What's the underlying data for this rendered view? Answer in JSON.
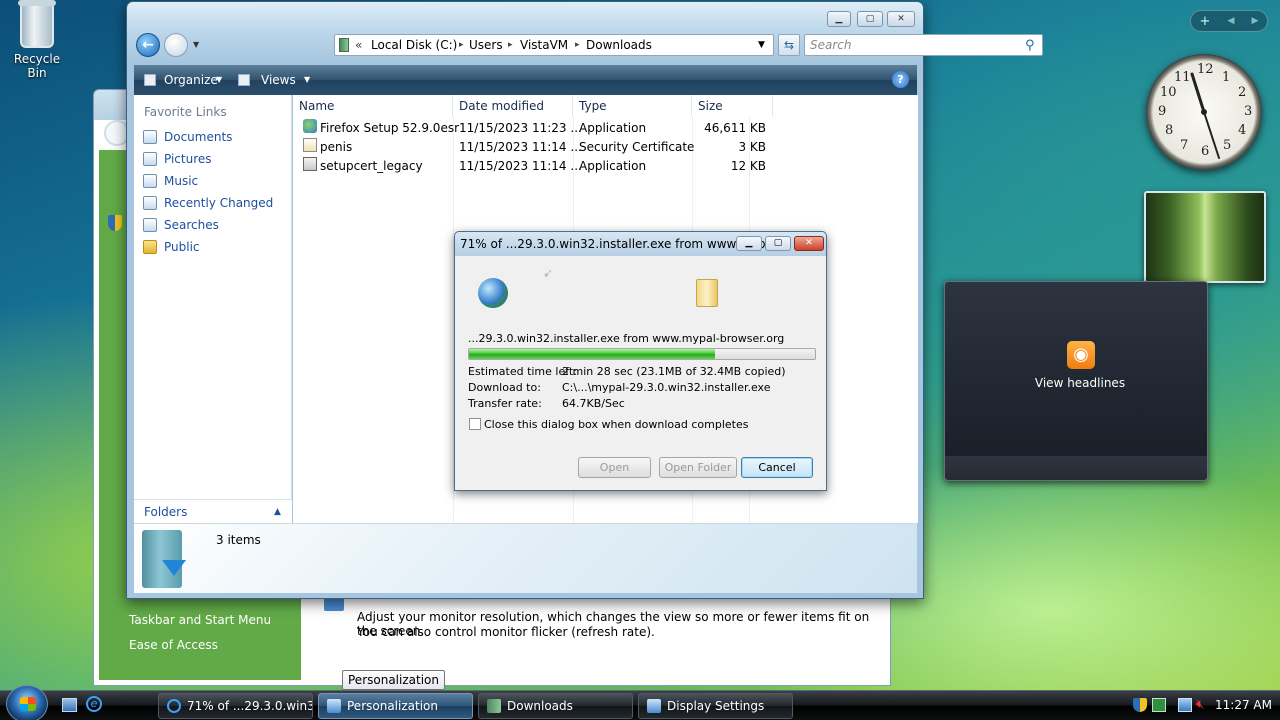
{
  "desktop": {
    "recycle_bin_label": "Recycle Bin"
  },
  "gadgets": {
    "toolbar_add": "+",
    "toolbar_prev": "◀",
    "toolbar_next": "▶",
    "clock_numbers": [
      "12",
      "1",
      "2",
      "3",
      "4",
      "5",
      "6",
      "7",
      "8",
      "9",
      "10",
      "11"
    ],
    "feed_label": "View headlines"
  },
  "background_window": {
    "links": [
      "Taskbar and Start Menu",
      "Ease of Access"
    ],
    "description_line1": "Adjust your monitor resolution, which changes the view so more or fewer items fit on the screen.",
    "description_line2": "You can also control monitor flicker (refresh rate)."
  },
  "explorer": {
    "address_prefix": "«",
    "breadcrumb": [
      "Local Disk (C:)",
      "Users",
      "VistaVM",
      "Downloads"
    ],
    "search_placeholder": "Search",
    "organize_label": "Organize",
    "views_label": "Views",
    "help_icon": "?",
    "favorite_links_header": "Favorite Links",
    "favorite_links": [
      "Documents",
      "Pictures",
      "Music",
      "Recently Changed",
      "Searches",
      "Public"
    ],
    "folders_label": "Folders",
    "columns": [
      "Name",
      "Date modified",
      "Type",
      "Size"
    ],
    "files": [
      {
        "name": "Firefox Setup 52.9.0esr",
        "date": "11/15/2023 11:23 ...",
        "type": "Application",
        "size": "46,611 KB"
      },
      {
        "name": "penis",
        "date": "11/15/2023 11:14 ...",
        "type": "Security Certificate",
        "size": "3 KB"
      },
      {
        "name": "setupcert_legacy",
        "date": "11/15/2023 11:14 ...",
        "type": "Application",
        "size": "12 KB"
      }
    ],
    "item_count": "3 items"
  },
  "download_dialog": {
    "title": "71% of ...29.3.0.win32.installer.exe from www.myp...",
    "source": "...29.3.0.win32.installer.exe from www.mypal-browser.org",
    "progress_fraction": 0.71,
    "estimated_label": "Estimated time left:",
    "estimated_value": "2 min 28 sec (23.1MB of 32.4MB copied)",
    "download_to_label": "Download to:",
    "download_to_value": "C:\\...\\mypal-29.3.0.win32.installer.exe",
    "rate_label": "Transfer rate:",
    "rate_value": "64.7KB/Sec",
    "close_checkbox_label": "Close this dialog box when download completes",
    "open_button": "Open",
    "open_folder_button": "Open Folder",
    "cancel_button": "Cancel"
  },
  "taskbar": {
    "tasks": [
      "71% of ...29.3.0.win3...",
      "Personalization",
      "Downloads",
      "Display Settings"
    ],
    "tooltip": "Personalization",
    "time": "11:27 AM"
  },
  "colors": {
    "accent_link": "#1e4f9e",
    "progress_green": "#37c22a",
    "sidebar_green": "#62aa48"
  }
}
